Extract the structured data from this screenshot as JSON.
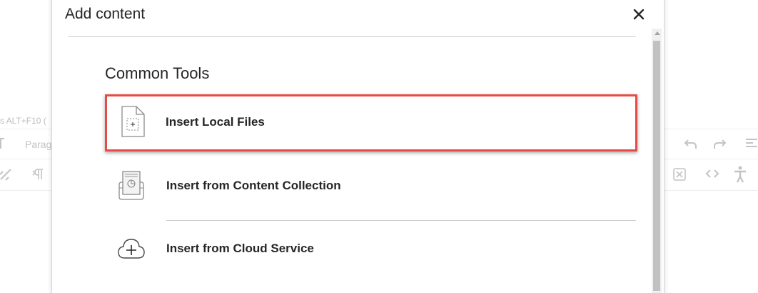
{
  "background_editor": {
    "shortcut_hint": "s ALT+F10 (",
    "paragraph_label": "Parag"
  },
  "modal": {
    "title": "Add content",
    "close_label": "✕",
    "section_title": "Common Tools",
    "options": [
      {
        "label": "Insert Local Files",
        "icon": "file-add-icon",
        "selected": true
      },
      {
        "label": "Insert from Content Collection",
        "icon": "content-collection-icon",
        "selected": false
      },
      {
        "label": "Insert from Cloud Service",
        "icon": "cloud-add-icon",
        "selected": false
      }
    ]
  },
  "colors": {
    "highlight_border": "#e64c45",
    "text": "#262626",
    "divider": "#cdcdcd"
  }
}
